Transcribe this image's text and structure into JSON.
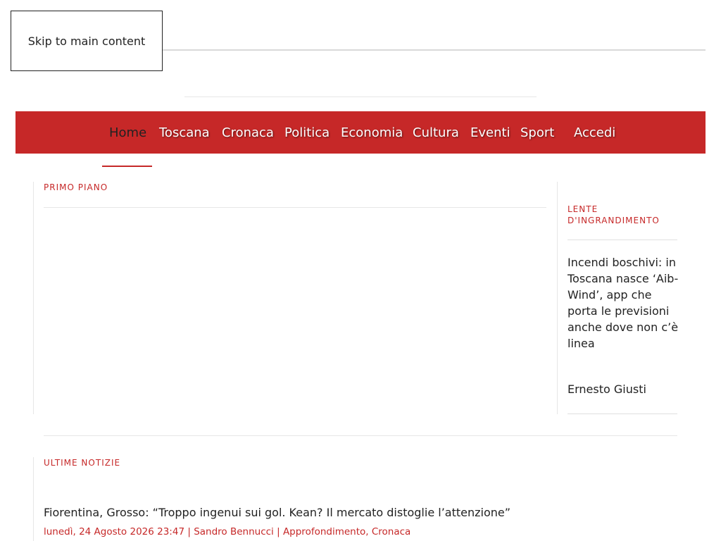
{
  "skip_link": "Skip to main content",
  "nav": {
    "items": [
      {
        "label": "Home",
        "active": true
      },
      {
        "label": "Toscana",
        "active": false
      },
      {
        "label": "Cronaca",
        "active": false
      },
      {
        "label": "Politica",
        "active": false
      },
      {
        "label": "Economia",
        "active": false
      },
      {
        "label": "Cultura",
        "active": false
      },
      {
        "label": "Eventi",
        "active": false
      },
      {
        "label": "Sport",
        "active": false
      }
    ],
    "login": "Accedi"
  },
  "primo_piano": {
    "label": "PRIMO PIANO"
  },
  "lente": {
    "label": "LENTE D'INGRANDIMENTO",
    "article_title": "Incendi boschivi: in Toscana nasce ‘Aib-Wind’, app che porta le previsioni anche dove non c’è linea",
    "author": "Ernesto Giusti"
  },
  "ultime_notizie": {
    "label": "ULTIME NOTIZIE",
    "items": [
      {
        "title": "Fiorentina, Grosso: “Troppo ingenui sui gol. Kean? Il mercato distoglie l’attenzione”",
        "date": "lunedì, 24 Agosto 2026 23:47",
        "author": "Sandro Bennucci",
        "categories": "Approfondimento, Cronaca"
      }
    ]
  },
  "colors": {
    "accent": "#c62828",
    "text": "#222222",
    "rule": "#e6e6e6"
  }
}
